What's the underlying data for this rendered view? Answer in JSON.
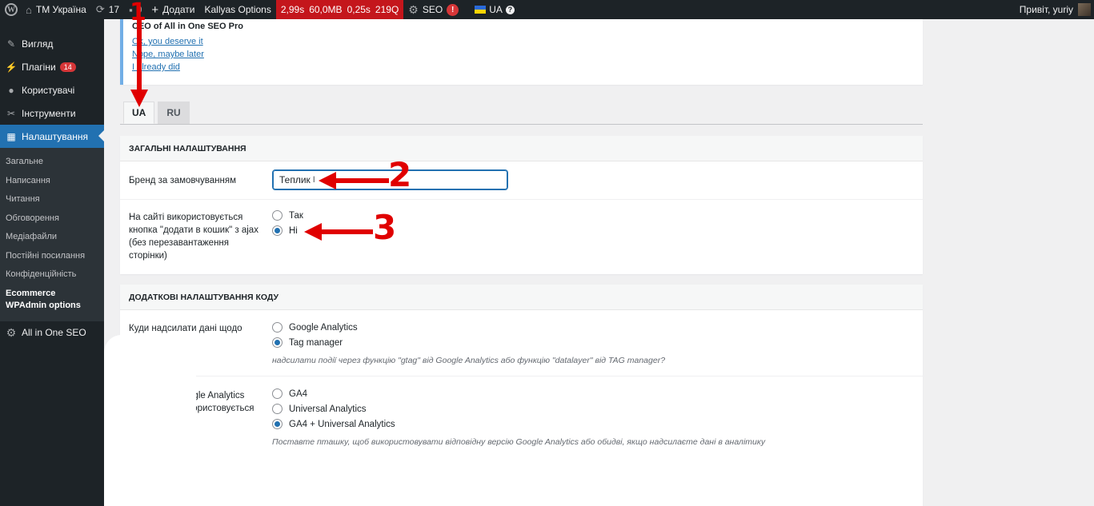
{
  "adminbar": {
    "site_name": "ТМ Україна",
    "updates_count": "17",
    "comments_count": "0",
    "new_label": "Додати",
    "theme_options": "Kallyas Options",
    "perf": [
      "2,99s",
      "60,0MB",
      "0,25s",
      "219Q"
    ],
    "seo_label": "SEO",
    "seo_badge": "!",
    "lang_label": "UA",
    "help_label": "?",
    "greeting": "Привіт, yuriy"
  },
  "sidebar": {
    "items": [
      {
        "label": "Вигляд",
        "icon": "brush-icon"
      },
      {
        "label": "Плагіни",
        "icon": "plugin-icon",
        "count": "14"
      },
      {
        "label": "Користувачі",
        "icon": "user-icon"
      },
      {
        "label": "Інструменти",
        "icon": "wrench-icon"
      },
      {
        "label": "Налаштування",
        "icon": "settings-icon"
      }
    ],
    "submenu": [
      "Загальне",
      "Написання",
      "Читання",
      "Обговорення",
      "Медіафайли",
      "Постійні посилання",
      "Конфіденційність",
      "Ecommerce WPAdmin options"
    ],
    "aioseo": "All in One SEO"
  },
  "notice": {
    "title": "CEO of All in One SEO Pro",
    "links": [
      "Ok, you deserve it",
      "Nope, maybe later",
      "I already did"
    ]
  },
  "tabs": [
    "UA",
    "RU"
  ],
  "general": {
    "title": "Загальні налаштування",
    "brand_label": "Бренд за замовчуванням",
    "brand_value": "Теплик",
    "ajax_label": "На сайті використовується кнопка \"додати в кошик\" з ajax (без перезавантаження сторінки)",
    "ajax_options": [
      "Так",
      "Ні"
    ],
    "ajax_selected": 1
  },
  "code": {
    "title": "Додаткові налаштування коду",
    "events_label": "Куди надсилати дані щодо подій?",
    "events_options": [
      "Google Analytics",
      "Tag manager"
    ],
    "events_selected": 1,
    "events_desc": "надсилати події через функцію \"gtag\" від Google Analytics або функцію \"datalayer\" від TAG manager?",
    "version_label_line1": "сія Google Analytics",
    "version_label_line2": "о не використовується",
    "version_options": [
      "GA4",
      "Universal Analytics",
      "GA4 + Universal Analytics"
    ],
    "version_selected": 2,
    "version_desc": "Поставте пташку, щоб використовувати відповідну версію Google Analytics або обидві, якщо надсилаєте дані в аналітику"
  },
  "annotations": [
    "1",
    "2",
    "3"
  ],
  "colors": {
    "admin_bar": "#1d2327",
    "accent": "#2271b1",
    "perf_bar": "#c4161c",
    "annotation": "#e00000"
  }
}
